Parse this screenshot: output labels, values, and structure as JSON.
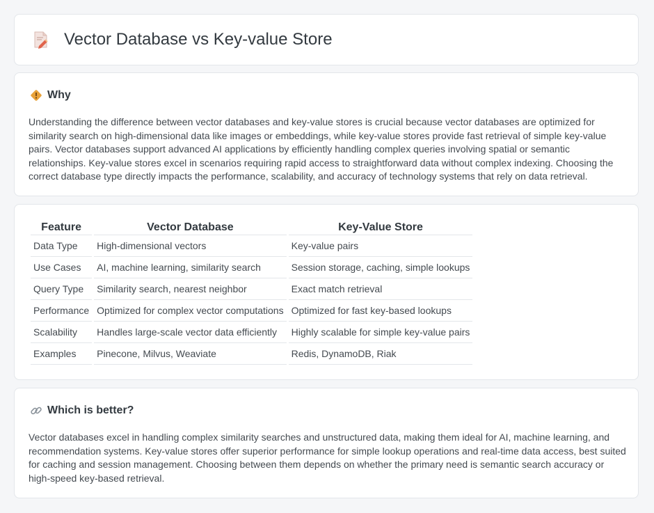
{
  "page": {
    "title": "Vector Database vs Key-value Store"
  },
  "why": {
    "heading": "Why",
    "icon": "diamond-warning-icon",
    "text": "Understanding the difference between vector databases and key-value stores is crucial because vector databases are optimized for similarity search on high-dimensional data like images or embeddings, while key-value stores provide fast retrieval of simple key-value pairs. Vector databases support advanced AI applications by efficiently handling complex queries involving spatial or semantic relationships. Key-value stores excel in scenarios requiring rapid access to straightforward data without complex indexing. Choosing the correct database type directly impacts the performance, scalability, and accuracy of technology systems that rely on data retrieval."
  },
  "comparison": {
    "headers": [
      "Feature",
      "Vector Database",
      "Key-Value Store"
    ],
    "rows": [
      [
        "Data Type",
        "High-dimensional vectors",
        "Key-value pairs"
      ],
      [
        "Use Cases",
        "AI, machine learning, similarity search",
        "Session storage, caching, simple lookups"
      ],
      [
        "Query Type",
        "Similarity search, nearest neighbor",
        "Exact match retrieval"
      ],
      [
        "Performance",
        "Optimized for complex vector computations",
        "Optimized for fast key-based lookups"
      ],
      [
        "Scalability",
        "Handles large-scale vector data efficiently",
        "Highly scalable for simple key-value pairs"
      ],
      [
        "Examples",
        "Pinecone, Milvus, Weaviate",
        "Redis, DynamoDB, Riak"
      ]
    ]
  },
  "better": {
    "heading": "Which is better?",
    "icon": "link-icon",
    "text": "Vector databases excel in handling complex similarity searches and unstructured data, making them ideal for AI, machine learning, and recommendation systems. Key-value stores offer superior performance for simple lookup operations and real-time data access, best suited for caching and session management. Choosing between them depends on whether the primary need is semantic search accuracy or high-speed key-based retrieval."
  },
  "colors": {
    "background": "#f5f6f8",
    "card": "#ffffff",
    "border": "#e3e6ea",
    "icon_accent": "#e8a23a",
    "icon_pencil": "#e0644c"
  }
}
